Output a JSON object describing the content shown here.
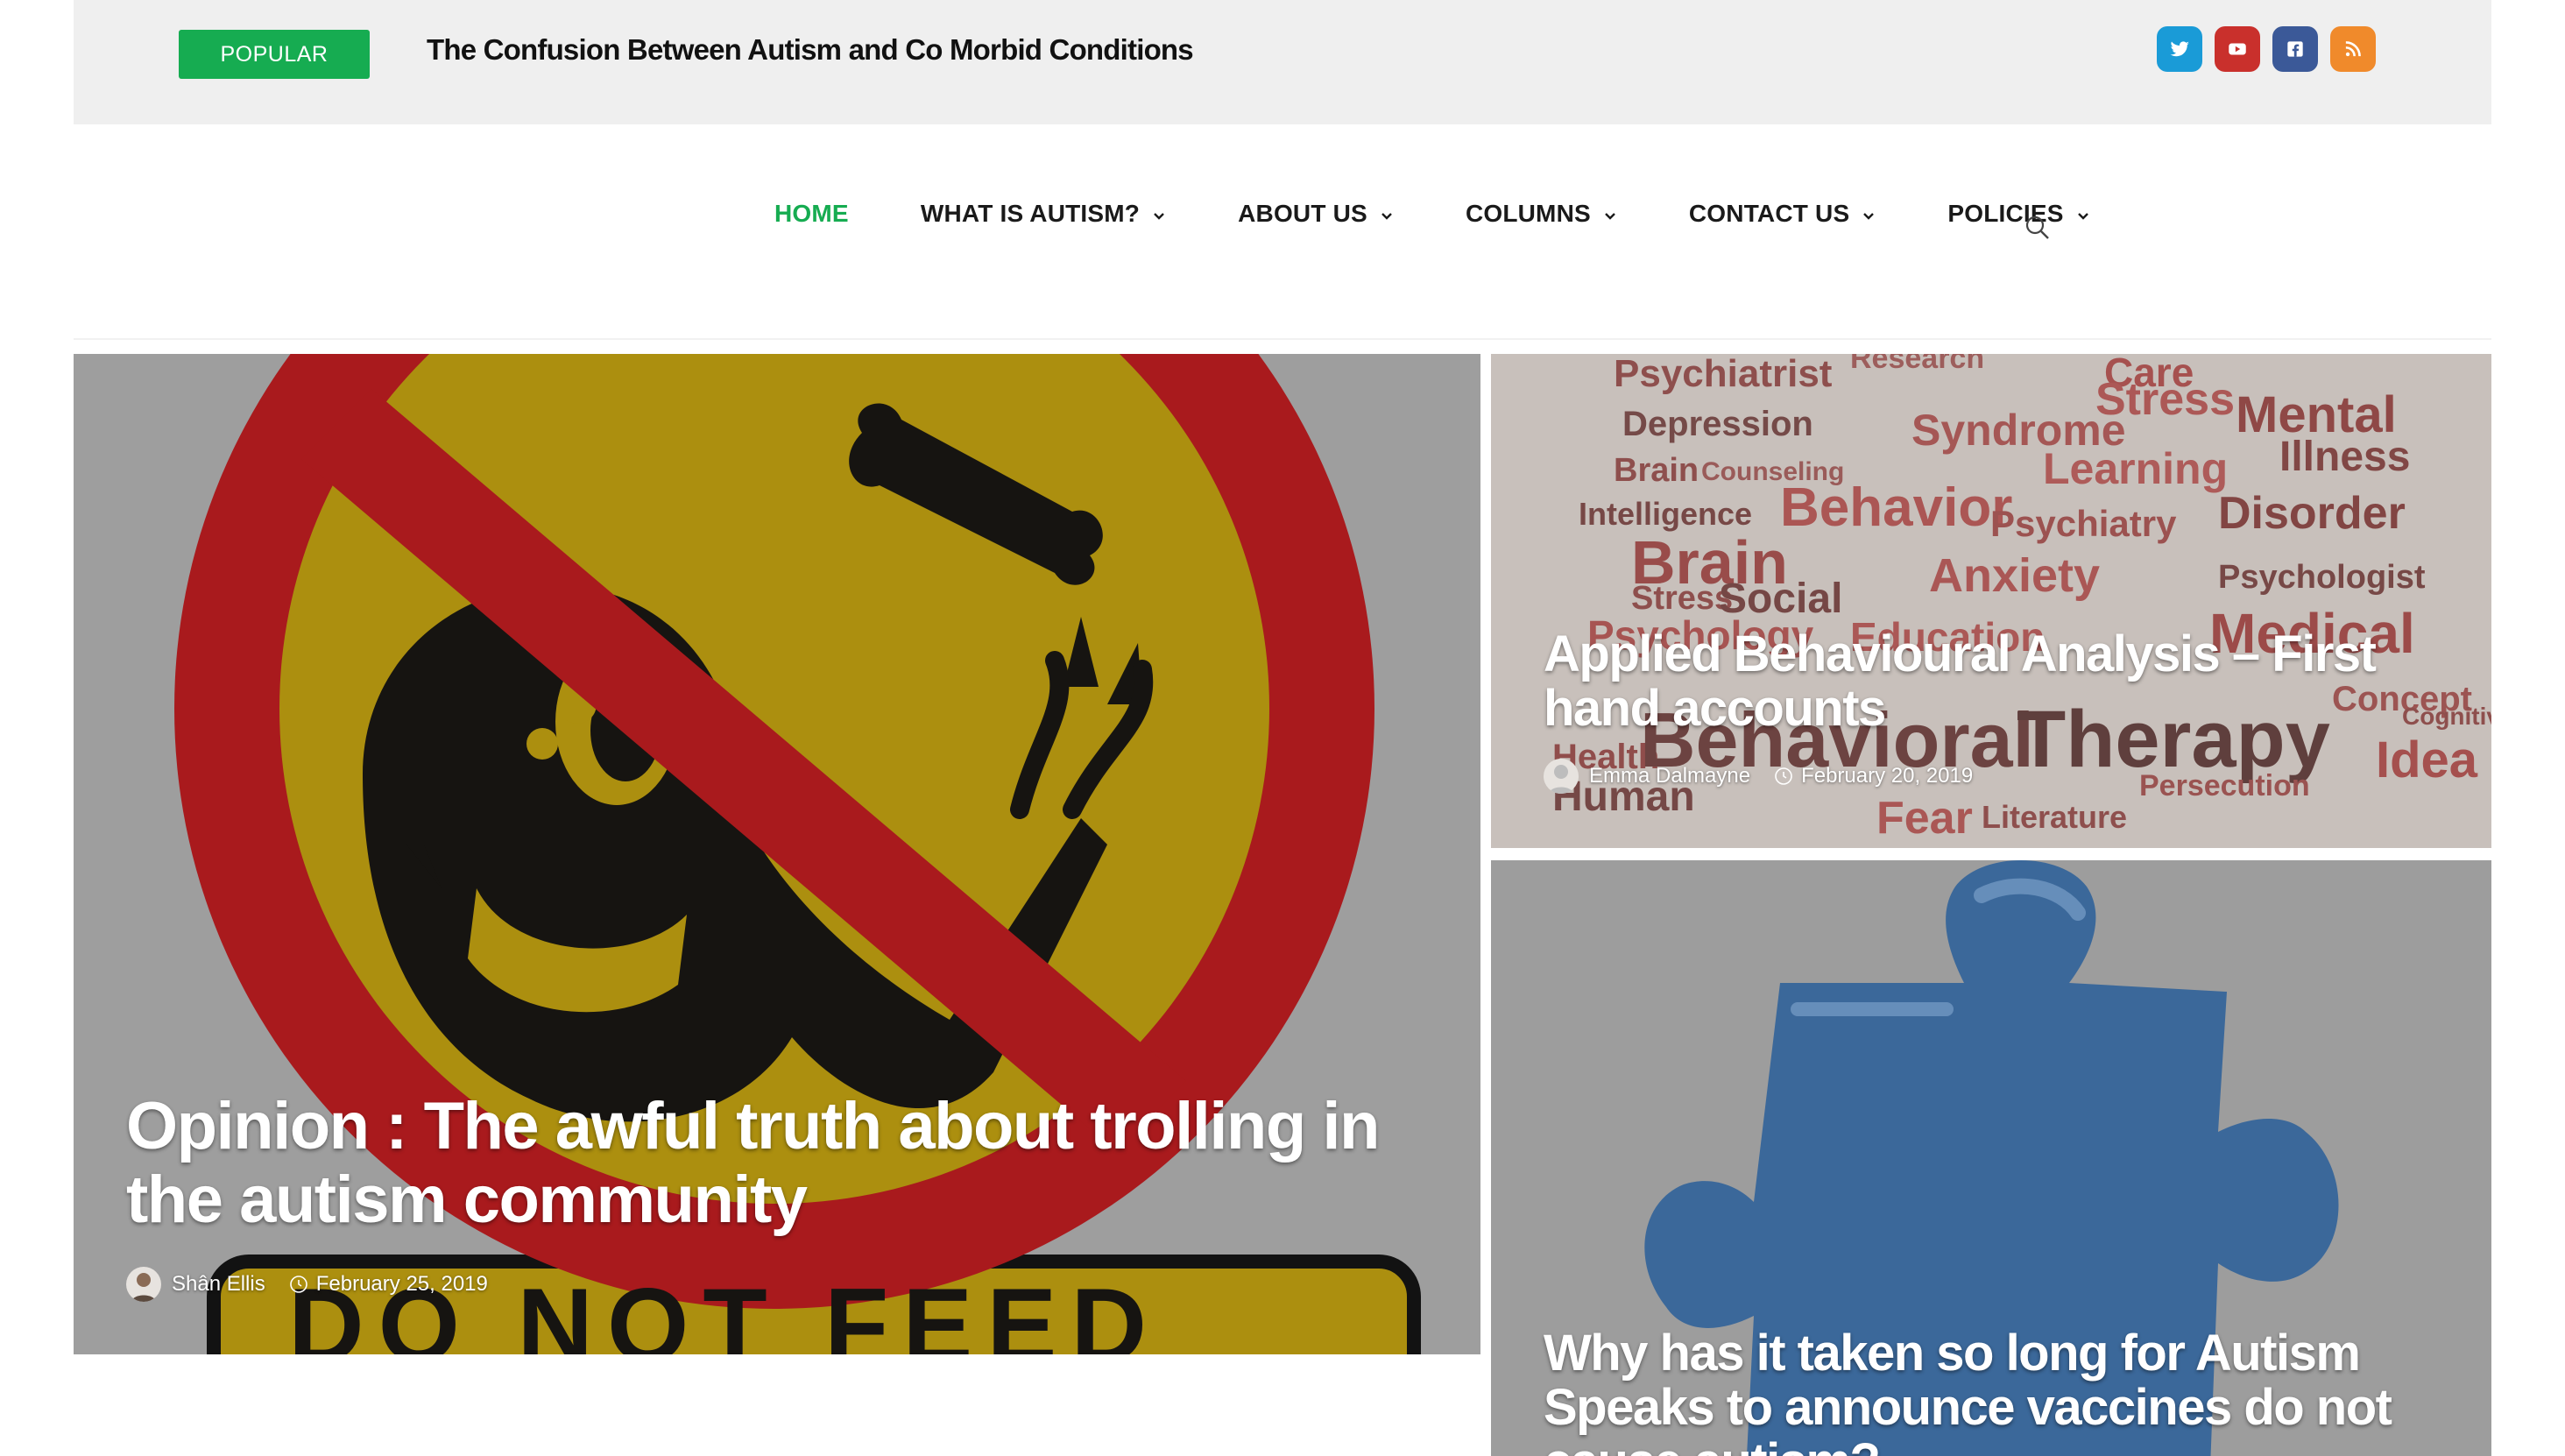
{
  "topbar": {
    "popular_label": "POPULAR",
    "ticker_title": "The Confusion Between Autism and Co Morbid Conditions",
    "social": [
      {
        "icon": "twitter-icon",
        "color": "#1a9bd7"
      },
      {
        "icon": "youtube-icon",
        "color": "#c9302c"
      },
      {
        "icon": "facebook-icon",
        "color": "#3b5998"
      },
      {
        "icon": "rss-icon",
        "color": "#f08a2b"
      }
    ]
  },
  "nav": {
    "items": [
      {
        "label": "HOME",
        "active": true
      },
      {
        "label": "WHAT IS AUTISM?",
        "dropdown": true
      },
      {
        "label": "ABOUT US",
        "dropdown": true
      },
      {
        "label": "COLUMNS",
        "dropdown": true
      },
      {
        "label": "CONTACT US",
        "dropdown": true
      },
      {
        "label": "POLICIES",
        "dropdown": true
      }
    ],
    "search_icon": "search-icon"
  },
  "featured": {
    "main": {
      "title": "Opinion : The awful truth about trolling in the autism community",
      "author": "Shân Ellis",
      "date": "February 25, 2019",
      "image_text": "DO NOT FEED"
    },
    "side": [
      {
        "title": "Applied Behavioural Analysis – First hand accounts",
        "author": "Emma Dalmayne",
        "date": "February 20, 2019",
        "image_words": [
          "Psychiatrist",
          "Research",
          "Care",
          "Stress",
          "Mental",
          "Depression",
          "Syndrome",
          "Illness",
          "Brain",
          "Counseling",
          "Learning",
          "Behavior",
          "Intelligence",
          "Psychiatry",
          "Disorder",
          "Brain",
          "Anxiety",
          "Stress",
          "Social",
          "Psychologist",
          "Psychology",
          "Education",
          "Medical",
          "Health",
          "Behavioral",
          "Therapy",
          "Idea",
          "Fear",
          "Literature",
          "Concept",
          "Persecution",
          "Cognitive",
          "Human"
        ]
      },
      {
        "title": "Why has it taken so long for Autism Speaks to announce vaccines do not cause autism?"
      }
    ]
  },
  "colors": {
    "accent": "#16ac51",
    "topbar_bg": "#efefef",
    "sign_red": "#b5191d",
    "sign_yellow": "#b8980e",
    "puzzle_blue": "#3d6ea4"
  }
}
